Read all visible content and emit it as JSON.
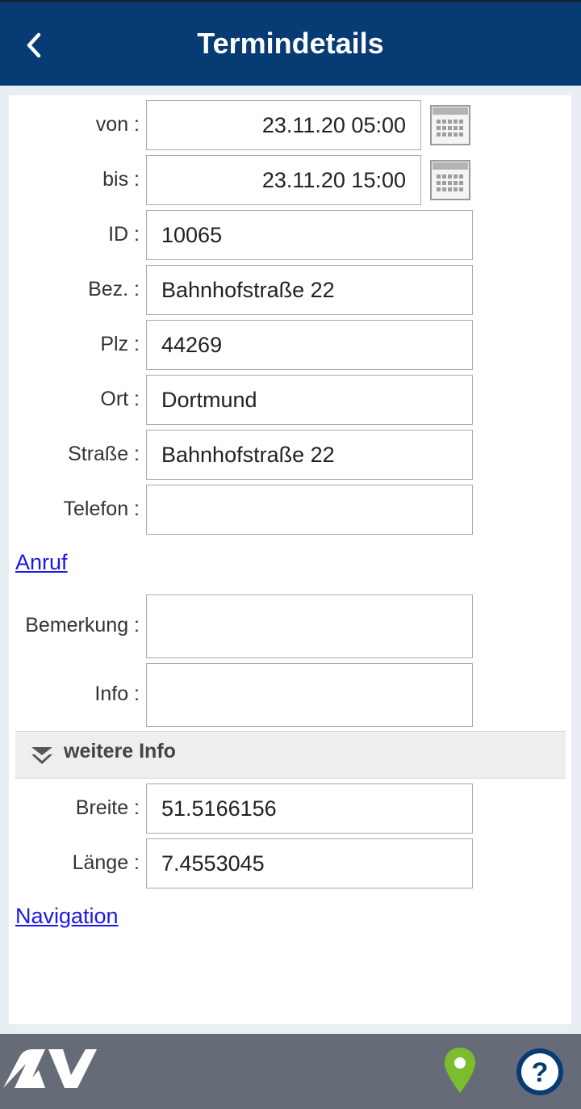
{
  "header": {
    "title": "Termindetails"
  },
  "form": {
    "von": {
      "label": "von :",
      "value": "23.11.20 05:00"
    },
    "bis": {
      "label": "bis :",
      "value": "23.11.20 15:00"
    },
    "id": {
      "label": "ID :",
      "value": "10065"
    },
    "bez": {
      "label": "Bez. :",
      "value": "Bahnhofstraße 22"
    },
    "plz": {
      "label": "Plz :",
      "value": "44269"
    },
    "ort": {
      "label": "Ort :",
      "value": "Dortmund"
    },
    "strasse": {
      "label": "Straße :",
      "value": "Bahnhofstraße 22"
    },
    "telefon": {
      "label": "Telefon :",
      "value": ""
    },
    "anruf_link": "Anruf",
    "bemerkung": {
      "label": "Bemerkung :",
      "value": ""
    },
    "info": {
      "label": "Info :",
      "value": ""
    },
    "weitere_info": "weitere Info",
    "breite": {
      "label": "Breite :",
      "value": "51.5166156"
    },
    "laenge": {
      "label": "Länge :",
      "value": "7.4553045"
    },
    "navigation_link": "Navigation"
  },
  "icons": {
    "back": "chevron-left-icon",
    "calendar": "calendar-icon",
    "expand": "double-chevron-down-icon",
    "logo": "av-logo",
    "location": "map-pin-icon",
    "help": "question-mark-icon"
  },
  "colors": {
    "header_bg": "#063b73",
    "footer_bg": "#656c78",
    "link": "#1a1ae6",
    "pin": "#7cbd2e",
    "help_ring": "#063b73"
  }
}
